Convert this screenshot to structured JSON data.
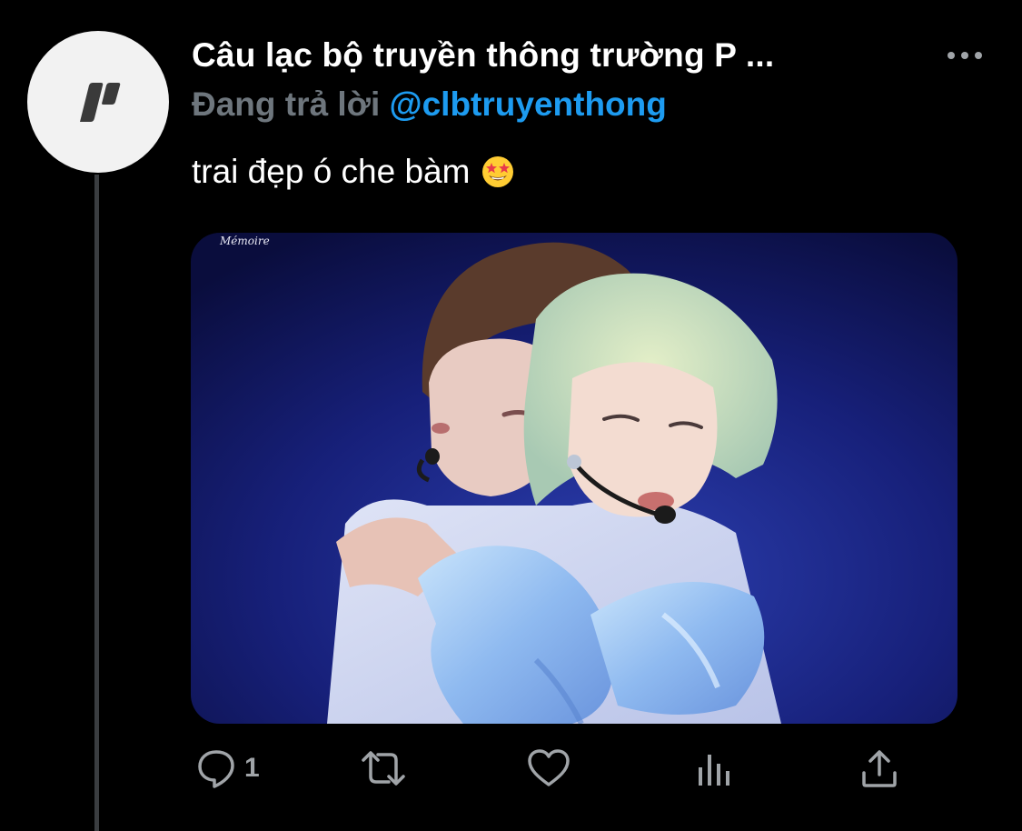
{
  "tweet": {
    "display_name": "Câu lạc bộ truyền thông trường P ...",
    "reply_prefix": "Đang trả lời ",
    "reply_handle": "@clbtruyenthong",
    "text": "trai đẹp ó che bàm",
    "emoji": "star-struck-emoji",
    "media": {
      "watermark": "Mémoire",
      "description_icon": "photo-image"
    }
  },
  "actions": {
    "reply_count": "1",
    "reply_icon": "comment-icon",
    "retweet_icon": "retweet-icon",
    "like_icon": "heart-icon",
    "analytics_icon": "analytics-icon",
    "share_icon": "share-icon"
  },
  "colors": {
    "background": "#000000",
    "text_primary": "#ffffff",
    "text_secondary": "#6e767d",
    "link": "#1d9bf0",
    "icon": "#a0a4a8",
    "thread_line": "#3a3d40"
  }
}
